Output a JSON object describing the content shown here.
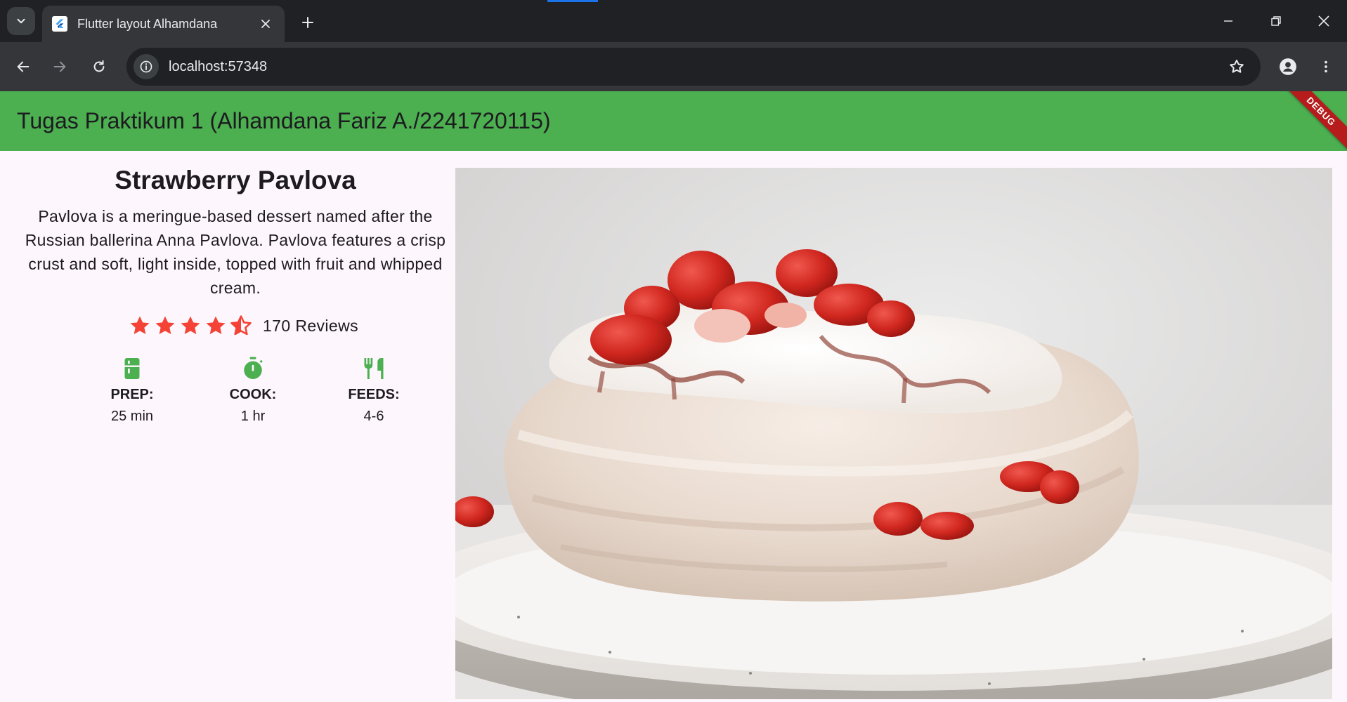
{
  "browser": {
    "tab_title": "Flutter layout Alhamdana",
    "url": "localhost:57348",
    "icons": {
      "tab_search": "chevron-down-icon",
      "tab_close": "close-icon",
      "new_tab": "plus-icon",
      "minimize": "minimize-icon",
      "restore": "restore-icon",
      "close_window": "close-icon",
      "back": "arrow-left-icon",
      "forward": "arrow-right-icon",
      "reload": "reload-icon",
      "site_info": "info-icon",
      "bookmark": "star-outline-icon",
      "profile": "person-icon",
      "menu": "kebab-menu-icon"
    }
  },
  "app": {
    "title": "Tugas Praktikum 1 (Alhamdana Fariz A./2241720115)",
    "debug_banner": "DEBUG",
    "colors": {
      "appbar": "#4caf50",
      "accent": "#4caf50",
      "star": "#f44336",
      "background": "#fdf7fd"
    }
  },
  "recipe": {
    "title": "Strawberry Pavlova",
    "description": "Pavlova is a meringue-based dessert named after the Russian ballerina Anna Pavlova. Pavlova features a crisp crust and soft, light inside, topped with fruit and whipped cream.",
    "rating": 4.5,
    "rating_max": 5,
    "reviews": "170 Reviews",
    "info": [
      {
        "icon": "kitchen-icon",
        "label": "PREP:",
        "value": "25 min"
      },
      {
        "icon": "timer-icon",
        "label": "COOK:",
        "value": "1 hr"
      },
      {
        "icon": "restaurant-icon",
        "label": "FEEDS:",
        "value": "4-6"
      }
    ],
    "image": "strawberry-pavlova-photo"
  }
}
